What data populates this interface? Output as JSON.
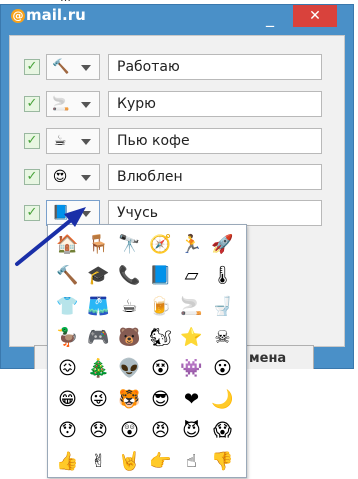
{
  "window": {
    "logo_at": "@",
    "logo_text": "mail.ru",
    "minimize_glyph": "_",
    "close_glyph": "✕"
  },
  "statuses": [
    {
      "checked": true,
      "icon": "squeaky-hammer-icon",
      "glyph": "🔨",
      "text": "Работаю"
    },
    {
      "checked": true,
      "icon": "cigarette-icon",
      "glyph": "🚬",
      "text": "Курю"
    },
    {
      "checked": true,
      "icon": "coffee-cup-icon",
      "glyph": "☕",
      "text": "Пью кофе"
    },
    {
      "checked": true,
      "icon": "in-love-smiley-icon",
      "glyph": "😍",
      "text": "Влюблен"
    },
    {
      "checked": true,
      "icon": "eraser-icon",
      "glyph": "📘",
      "text": "Учусь"
    }
  ],
  "buttons": {
    "cancel_label_fragment": "мена"
  },
  "emoji_grid": [
    [
      "🏠",
      "🪑",
      "🔭",
      "🧭",
      "🏃",
      "🚀"
    ],
    [
      "🔨",
      "🎓",
      "📞",
      "📘",
      "▱",
      "🌡"
    ],
    [
      "👕",
      "🩳",
      "☕",
      "🍺",
      "🚬",
      "🚽"
    ],
    [
      "🦆",
      "🎮",
      "🐻",
      "🐿",
      "⭐",
      "☠"
    ],
    [
      "😖",
      "🎄",
      "👽",
      "😵",
      "👾",
      "😮"
    ],
    [
      "😁",
      "😜",
      "🐯",
      "😎",
      "❤",
      "🌙"
    ],
    [
      "😯",
      "😞",
      "😲",
      "😠",
      "😈",
      "😱"
    ],
    [
      "👍",
      "✌",
      "🤘",
      "👉",
      "☝",
      "👎"
    ]
  ],
  "colors": {
    "window_blue": "#4a90c8",
    "close_red": "#d9423c",
    "pointer_arrow": "#1a2fa8"
  }
}
